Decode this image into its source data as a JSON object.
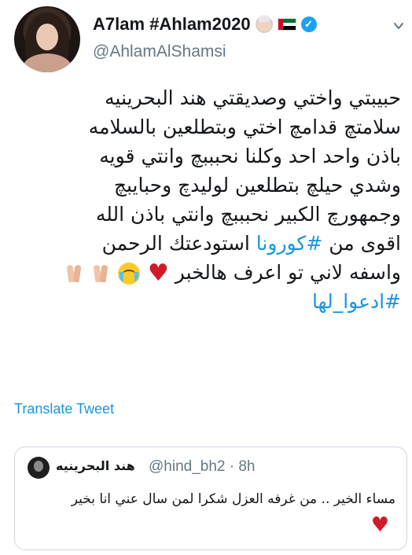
{
  "author": {
    "display_name": "A7lam #Ahlam2020",
    "handle": "@AhlamAlShamsi",
    "icons": [
      "woman-with-veil-emoji",
      "uae-flag-emoji",
      "verified-badge-icon"
    ]
  },
  "tweet": {
    "lines": [
      "حبيبتي واختي وصديقتي هند البحرينيه",
      "سلامتچ قدامچ اختي وبتطلعين بالسلامه",
      "باذن واحد احد وكلنا نحبببچ وانتي قويه",
      "وشدي حيلچ بتطلعين لوليدچ وحبايبچ",
      "وجمهورچ الكبير نحبببچ وانتي باذن الله"
    ],
    "line6_before": "اقوى من",
    "line6_hashtag": "#كورونا",
    "line6_after": "استودعتك الرحمن",
    "line7_text": "واسفه لاني تو اعرف هالخبر",
    "line7_emojis": [
      "broken-heart-emoji",
      "crying-face-emoji",
      "pray-emoji",
      "pray-emoji"
    ],
    "hashtag_line": "#ادعوا_لها"
  },
  "translate_label": "Translate Tweet",
  "quoted": {
    "name": "هند البحرينيه",
    "handle_time": "@hind_bh2 · 8h",
    "text": "مساء الخير .. من غرفه العزل شكرا لمن سال عني انا بخير",
    "heart": "♥"
  },
  "colors": {
    "text": "#14171a",
    "secondary": "#657786",
    "link": "#1b95e0",
    "verified": "#1da1f2",
    "border": "#ccd6dd"
  }
}
